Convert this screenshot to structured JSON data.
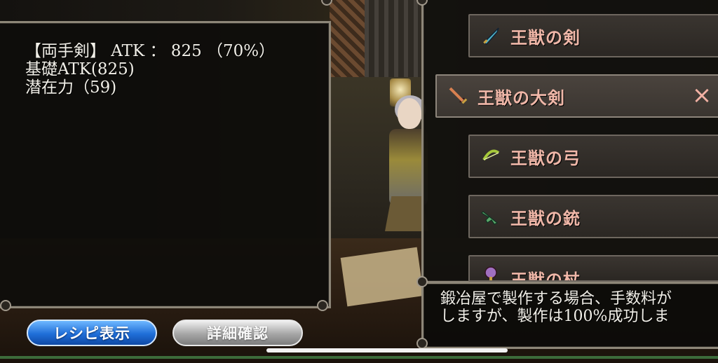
{
  "stats": {
    "line1": "【両手剣】 ATK ： 825 （70%）",
    "line2": "基礎ATK(825)",
    "line3": "潜在力（59)"
  },
  "weapon_list": [
    {
      "label": "王獣の剣",
      "icon": "sword-icon",
      "icon_color": "#4fb3c9",
      "selected": false
    },
    {
      "label": "王獣の大剣",
      "icon": "greatsword-icon",
      "icon_color": "#c95a3a",
      "selected": true
    },
    {
      "label": "王獣の弓",
      "icon": "bow-icon",
      "icon_color": "#a6c93a",
      "selected": false
    },
    {
      "label": "王獣の銃",
      "icon": "gun-icon",
      "icon_color": "#5aa86a",
      "selected": false
    },
    {
      "label": "王獣の杖",
      "icon": "staff-icon",
      "icon_color": "#a070c0",
      "selected": false
    }
  ],
  "close_label": "×",
  "description": {
    "line1": "鍛冶屋で製作する場合、手数料が",
    "line2": "しますが、製作は100%成功しま"
  },
  "buttons": {
    "recipe": "レシピ表示",
    "detail": "詳細確認"
  },
  "colors": {
    "label_text": "#f0b7a8",
    "recipe_button": "#1f6ed8",
    "detail_button": "#a6a6a6"
  }
}
